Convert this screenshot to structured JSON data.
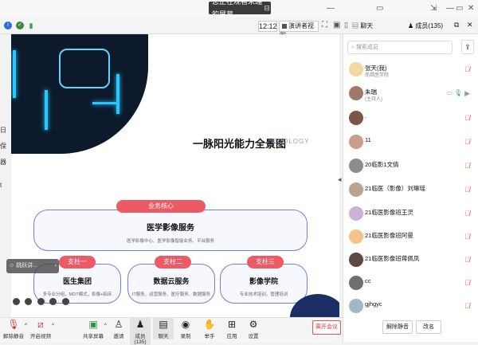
{
  "window": {
    "share_banner": "您正在观看朱瑞的屏幕",
    "collapse_icon": "chevron-left-icon"
  },
  "toolbar": {
    "time": "12:12",
    "view_mode": "演讲者视图"
  },
  "panel": {
    "tab_chat": "聊天",
    "tab_members": "成员(135)",
    "search_placeholder": "搜索成员",
    "members": [
      {
        "name": "张天(我)",
        "role": "南昌医学院",
        "mic": "off"
      },
      {
        "name": "朱瑞",
        "role": "(主持人)",
        "mic": "on"
      },
      {
        "name": ".",
        "role": "",
        "mic": "off"
      },
      {
        "name": "11",
        "role": "",
        "mic": "off"
      },
      {
        "name": "20临影1文倩",
        "role": "",
        "mic": "off"
      },
      {
        "name": "21临医（影像）刘琳瑶",
        "role": "",
        "mic": "off"
      },
      {
        "name": "21临医影像班王灵",
        "role": "",
        "mic": "off"
      },
      {
        "name": "21临医影像班阿曼",
        "role": "",
        "mic": "off"
      },
      {
        "name": "21临医影像班蒋佩凤",
        "role": "",
        "mic": "off"
      },
      {
        "name": "cc",
        "role": "",
        "mic": "off"
      },
      {
        "name": "gjhgyc",
        "role": "",
        "mic": "off"
      }
    ],
    "mute_all": "解除静音",
    "rename": "改名"
  },
  "slide": {
    "title": "一脉阳光能力全景图",
    "subtitle": "ECOLOGY",
    "core_tag": "业务核心",
    "core_title": "医学影像服务",
    "core_desc": "医学影像中心、医学影像智能业务、平台服务",
    "pillar1_tag": "支柱一",
    "pillar1_title": "医生集团",
    "pillar1_desc": "多专业分组，MDT模式，影像+临床",
    "pillar2_tag": "支柱二",
    "pillar2_title": "数据云服务",
    "pillar2_desc": "IT服务、运营服务、医疗服务、数据服务",
    "pillar3_tag": "支柱三",
    "pillar3_title": "影像学院",
    "pillar3_desc": "专业技术培训，管理培训"
  },
  "presenter": {
    "label": "跳跃讲..."
  },
  "bottombar": {
    "mute": "解除静音",
    "video": "开启视频",
    "share": "共享屏幕",
    "invite": "邀请",
    "members": "成员(135)",
    "chat": "聊天",
    "record": "录制",
    "raise": "举手",
    "apps": "应用",
    "settings": "设置",
    "end": "离开会议"
  },
  "colors": {
    "accent_red": "#ec5a66",
    "panel_border": "#6d82d8",
    "danger": "#e33"
  }
}
